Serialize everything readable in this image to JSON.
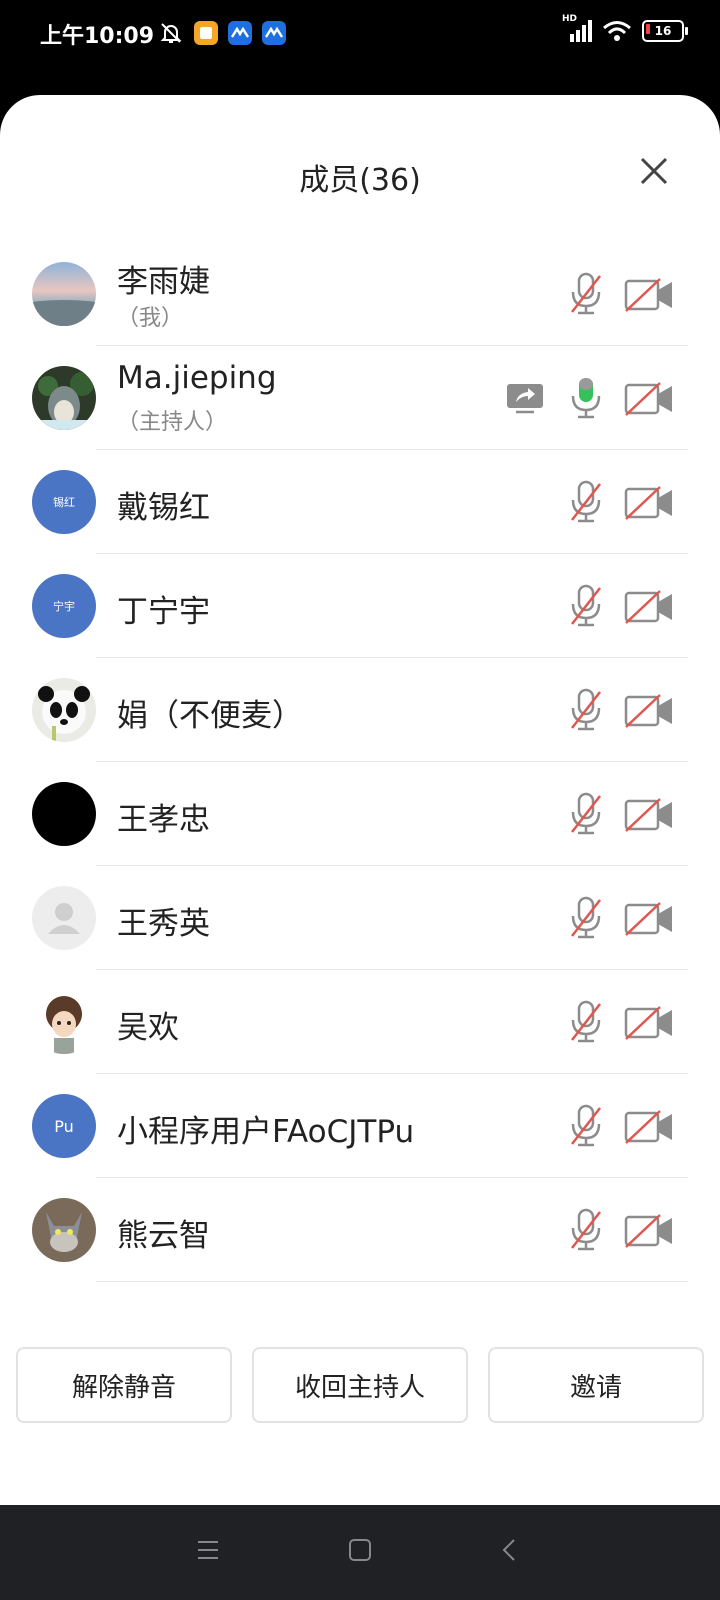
{
  "status_bar": {
    "time": "上午10:09",
    "battery": "16",
    "network": "HD"
  },
  "header": {
    "title": "成员(36)"
  },
  "members": [
    {
      "name": "李雨婕",
      "sub": "（我）",
      "avatar": {
        "type": "photo-sky"
      },
      "mic": "muted",
      "camera": "off"
    },
    {
      "name": "Ma.jieping",
      "sub": "（主持人）",
      "avatar": {
        "type": "photo-totoro"
      },
      "mic": "active",
      "camera": "off",
      "screen_share": true
    },
    {
      "name": "戴锡红",
      "avatar": {
        "type": "text",
        "text": "锡红",
        "color": "#4a74c4"
      },
      "mic": "muted",
      "camera": "off"
    },
    {
      "name": "丁宁宇",
      "avatar": {
        "type": "text",
        "text": "宁宇",
        "color": "#4a74c4"
      },
      "mic": "muted",
      "camera": "off"
    },
    {
      "name": "娟（不便麦）",
      "avatar": {
        "type": "photo-panda"
      },
      "mic": "muted",
      "camera": "off"
    },
    {
      "name": "王孝忠",
      "avatar": {
        "type": "solid",
        "color": "#000000"
      },
      "mic": "muted",
      "camera": "off"
    },
    {
      "name": "王秀英",
      "avatar": {
        "type": "default-person"
      },
      "mic": "muted",
      "camera": "off"
    },
    {
      "name": "吴欢",
      "avatar": {
        "type": "photo-cartoon"
      },
      "mic": "muted",
      "camera": "off"
    },
    {
      "name": "小程序用户FAoCJTPu",
      "avatar": {
        "type": "text",
        "text": "Pu",
        "color": "#4a74c4"
      },
      "mic": "muted",
      "camera": "off"
    },
    {
      "name": "熊云智",
      "avatar": {
        "type": "photo-cat"
      },
      "mic": "muted",
      "camera": "off"
    },
    {
      "name": "",
      "avatar": {
        "type": "photo-partial"
      },
      "mic": "muted",
      "camera": "off"
    }
  ],
  "actions": {
    "unmute_all": "解除静音",
    "reclaim_host": "收回主持人",
    "invite": "邀请"
  },
  "colors": {
    "accent_blue": "#4a74c4",
    "mic_active": "#36c25a",
    "muted_slash": "#e0574f",
    "icon_gray": "#8c8c8c"
  }
}
